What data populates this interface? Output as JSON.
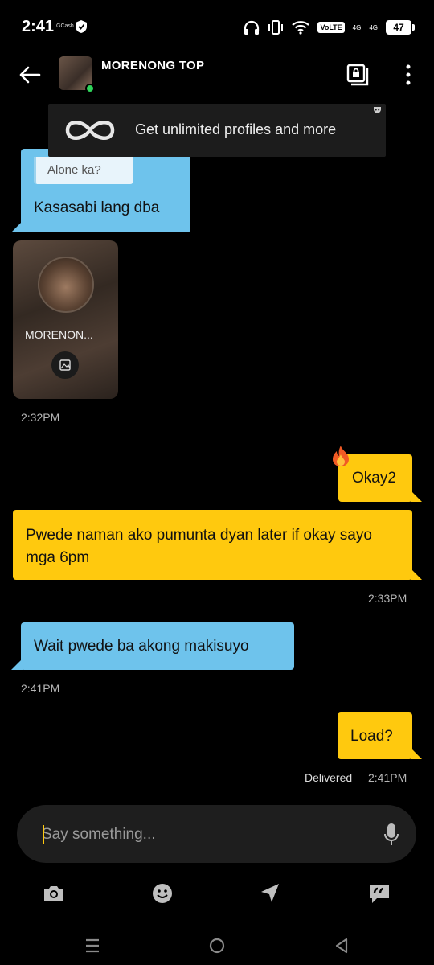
{
  "status_bar": {
    "time": "2:41",
    "carrier_app": "GCash",
    "volte": "VoLTE",
    "net1": "4G",
    "net2": "4G",
    "battery": "47"
  },
  "header": {
    "contact_name": "MORENONG TOP"
  },
  "promo": {
    "text": "Get unlimited profiles and more"
  },
  "messages": [
    {
      "quote": "Alone ka?",
      "text": "Kasasabi lang dba"
    },
    {
      "card_name": "MORENON...",
      "time": "2:32PM"
    },
    {
      "text": "Okay2"
    },
    {
      "text": "Pwede naman ako pumunta dyan later if okay sayo mga 6pm",
      "time": "2:33PM"
    },
    {
      "text": "Wait pwede ba akong makisuyo",
      "time": "2:41PM"
    },
    {
      "text": "Load?",
      "status": "Delivered",
      "time": "2:41PM"
    }
  ],
  "composer": {
    "placeholder": "Say something..."
  },
  "colors": {
    "incoming": "#6ec3ec",
    "outgoing": "#ffc90e",
    "background": "#000000"
  },
  "icons": [
    "back-arrow-icon",
    "album-icon",
    "more-vertical-icon",
    "infinity-icon",
    "camera-icon",
    "emoji-icon",
    "location-icon",
    "quick-replies-icon",
    "mic-icon",
    "fire-icon"
  ]
}
